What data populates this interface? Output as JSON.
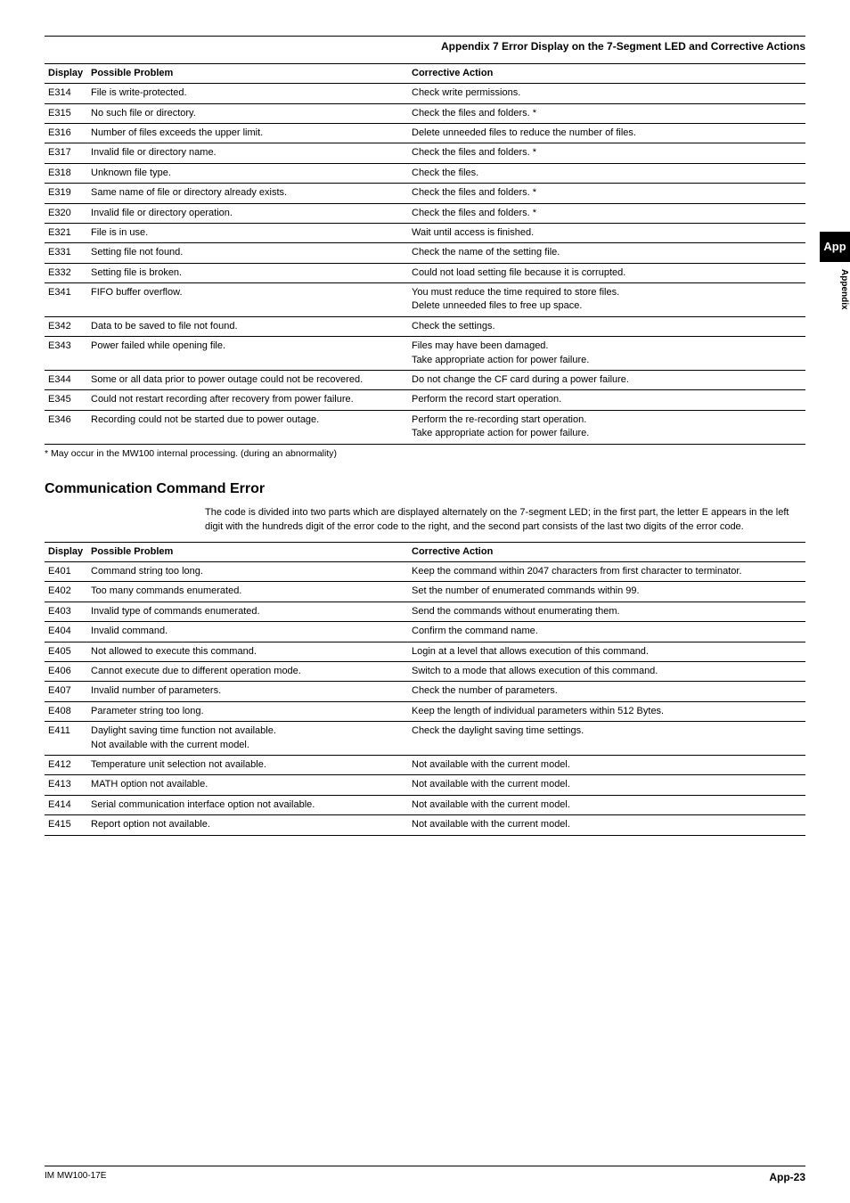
{
  "header_title": "Appendix 7  Error Display on the 7-Segment LED and Corrective Actions",
  "table1": {
    "headers": {
      "display": "Display",
      "problem": "Possible Problem",
      "action": "Corrective Action"
    },
    "rows": [
      {
        "d": "E314",
        "p": "File is write-protected.",
        "a": "Check write permissions."
      },
      {
        "d": "E315",
        "p": "No such file or directory.",
        "a": "Check the files and folders. *"
      },
      {
        "d": "E316",
        "p": "Number of files exceeds the upper limit.",
        "a": "Delete unneeded files to reduce the number of files."
      },
      {
        "d": "E317",
        "p": "Invalid file or directory name.",
        "a": "Check the files and folders. *"
      },
      {
        "d": "E318",
        "p": "Unknown file type.",
        "a": "Check the files."
      },
      {
        "d": "E319",
        "p": "Same name of file or directory already exists.",
        "a": "Check the files and folders. *"
      },
      {
        "d": "E320",
        "p": "Invalid file or directory operation.",
        "a": "Check the files and folders. *"
      },
      {
        "d": "E321",
        "p": "File is in use.",
        "a": "Wait until access is finished."
      },
      {
        "d": "E331",
        "p": "Setting file not found.",
        "a": "Check the name of the setting file."
      },
      {
        "d": "E332",
        "p": "Setting file is broken.",
        "a": "Could not load setting file because it is corrupted."
      },
      {
        "d": "E341",
        "p": "FIFO buffer overflow.",
        "a": "You must reduce the time required to store files.\nDelete unneeded files to free up space."
      },
      {
        "d": "E342",
        "p": "Data to be saved to file not found.",
        "a": "Check the settings."
      },
      {
        "d": "E343",
        "p": "Power failed while opening file.",
        "a": "Files may have been damaged.\nTake appropriate action for power failure."
      },
      {
        "d": "E344",
        "p": "Some or all data prior to power outage could not be recovered.",
        "a": "Do not change the CF card during a power failure."
      },
      {
        "d": "E345",
        "p": "Could not restart recording after recovery from power failure.",
        "a": "Perform the record start operation."
      },
      {
        "d": "E346",
        "p": "Recording could not be started due to power outage.",
        "a": "Perform the re-recording start operation.\nTake appropriate action for power failure."
      }
    ],
    "footnote": "* May occur in the MW100 internal processing. (during an abnormality)"
  },
  "section2": {
    "heading": "Communication Command Error",
    "intro": "The code is divided into two parts which are displayed alternately on the 7-segment LED; in the first part, the letter E appears in the left digit with the hundreds digit of the error code to the right, and the second part consists of the last two digits of the error code."
  },
  "table2": {
    "headers": {
      "display": "Display",
      "problem": "Possible Problem",
      "action": "Corrective Action"
    },
    "rows": [
      {
        "d": "E401",
        "p": "Command string too long.",
        "a": "Keep the command within 2047 characters from first character to terminator."
      },
      {
        "d": "E402",
        "p": "Too many commands enumerated.",
        "a": "Set the number of enumerated commands within 99."
      },
      {
        "d": "E403",
        "p": "Invalid type of commands enumerated.",
        "a": "Send the commands without enumerating them."
      },
      {
        "d": "E404",
        "p": "Invalid command.",
        "a": "Confirm the command name."
      },
      {
        "d": "E405",
        "p": "Not allowed to execute this command.",
        "a": "Login at a level that allows execution of this command."
      },
      {
        "d": "E406",
        "p": "Cannot execute due to different operation mode.",
        "a": "Switch to a mode that allows execution of this command."
      },
      {
        "d": "E407",
        "p": "Invalid number of parameters.",
        "a": "Check the number of parameters."
      },
      {
        "d": "E408",
        "p": "Parameter string too long.",
        "a": "Keep the length of individual parameters within 512 Bytes."
      },
      {
        "d": "E411",
        "p": "Daylight saving time function not available.\nNot available with the current model.",
        "a": "Check the daylight saving time settings."
      },
      {
        "d": "E412",
        "p": "Temperature unit selection not available.",
        "a": "Not available with the current model."
      },
      {
        "d": "E413",
        "p": "MATH option not available.",
        "a": "Not available with the current model."
      },
      {
        "d": "E414",
        "p": "Serial communication interface option not available.",
        "a": "Not available with the current model."
      },
      {
        "d": "E415",
        "p": "Report option not available.",
        "a": "Not available with the current model."
      }
    ]
  },
  "side": {
    "app": "App",
    "appendix": "Appendix"
  },
  "footer": {
    "left": "IM MW100-17E",
    "right": "App-23"
  }
}
